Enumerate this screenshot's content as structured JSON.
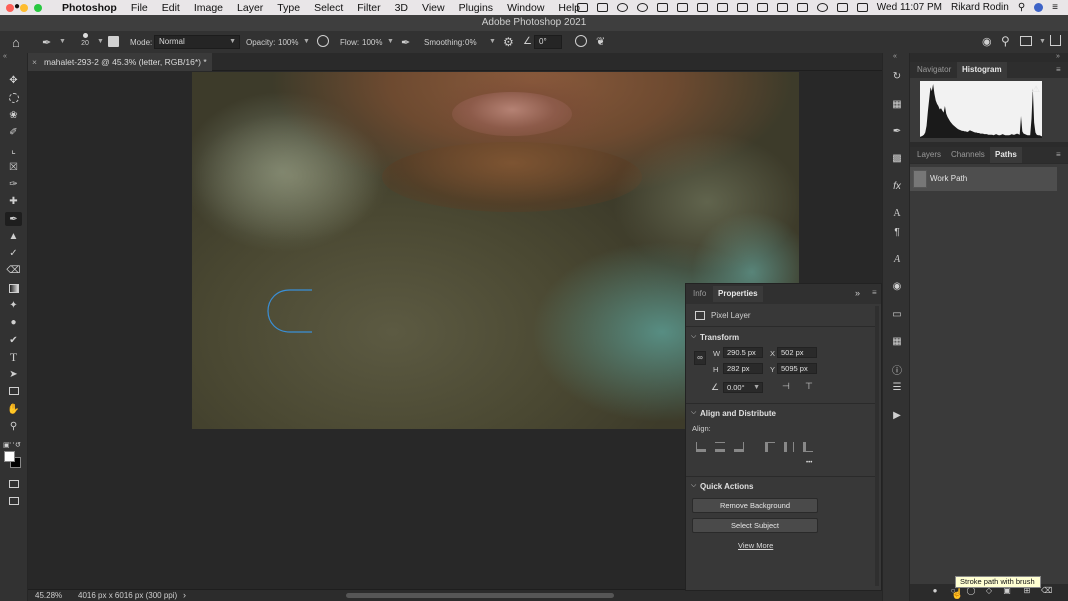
{
  "menubar": {
    "app_name": "Photoshop",
    "items": [
      "File",
      "Edit",
      "Image",
      "Layer",
      "Type",
      "Select",
      "Filter",
      "3D",
      "View",
      "Plugins",
      "Window",
      "Help"
    ],
    "clock": "Wed 11:07 PM",
    "user": "Rikard Rodin"
  },
  "window": {
    "title": "Adobe Photoshop 2021"
  },
  "options": {
    "brush_size": "20",
    "mode_label": "Mode:",
    "mode_value": "Normal",
    "opacity_label": "Opacity:",
    "opacity_value": "100%",
    "flow_label": "Flow:",
    "flow_value": "100%",
    "smoothing_label": "Smoothing:",
    "smoothing_value": "0%",
    "angle_value": "0°"
  },
  "document": {
    "tab_title": "mahalet-293-2 @ 45.3% (letter, RGB/16*) *",
    "close_glyph": "×"
  },
  "status": {
    "zoom": "45.28%",
    "doc_info": "4016 px x 6016 px (300 ppi)",
    "arrow": "›"
  },
  "top_panel": {
    "tabs": [
      "Navigator",
      "Histogram"
    ],
    "active": "Histogram",
    "histogram_values": [
      2,
      3,
      4,
      6,
      10,
      22,
      48,
      70,
      92,
      85,
      98,
      80,
      68,
      62,
      58,
      52,
      54,
      50,
      46,
      58,
      44,
      38,
      34,
      30,
      27,
      24,
      22,
      20,
      18,
      16,
      15,
      14,
      13,
      13,
      12,
      12,
      11,
      12,
      14,
      13,
      12,
      11,
      10,
      10,
      9,
      9,
      8,
      8,
      8,
      7,
      7,
      7,
      6,
      6,
      6,
      6,
      5,
      6,
      7,
      6,
      5,
      5,
      6,
      7,
      6,
      5,
      5,
      5,
      5,
      6,
      7,
      6,
      6,
      7,
      8,
      7,
      6,
      40,
      12,
      8,
      7,
      6,
      5,
      5,
      5,
      35,
      90,
      28,
      10,
      6,
      5,
      5,
      4,
      3
    ]
  },
  "layers_panel": {
    "tabs": [
      "Layers",
      "Channels",
      "Paths"
    ],
    "active": "Paths",
    "paths": [
      {
        "name": "Work Path"
      }
    ]
  },
  "properties": {
    "tabs": [
      "Info",
      "Properties"
    ],
    "active": "Properties",
    "expand_glyph": "»",
    "layer_kind": "Pixel Layer",
    "transform": {
      "title": "Transform",
      "w_label": "W",
      "w_value": "290.5 px",
      "x_label": "X",
      "x_value": "502 px",
      "h_label": "H",
      "h_value": "282 px",
      "y_label": "Y",
      "y_value": "5095 px",
      "angle_value": "0.00°"
    },
    "align": {
      "title": "Align and Distribute",
      "align_label": "Align:",
      "more_glyph": "•••"
    },
    "quick_actions": {
      "title": "Quick Actions",
      "remove_bg": "Remove Background",
      "select_subject": "Select Subject",
      "view_more": "View More"
    }
  },
  "tooltip": {
    "text": "Stroke path with brush"
  },
  "colors": {
    "foreground": "#ffffff",
    "background": "#000000",
    "path_stroke": "#3a8fd6",
    "accent": "#5b9bd5"
  }
}
